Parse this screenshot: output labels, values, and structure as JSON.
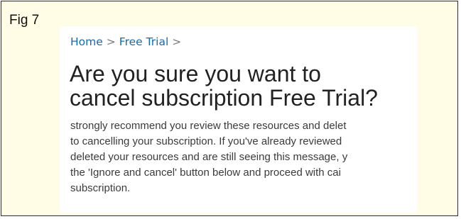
{
  "figure": {
    "label": "Fig 7"
  },
  "breadcrumb": {
    "home": "Home",
    "separator": ">",
    "free_trial": "Free Trial",
    "trailing_separator": ">"
  },
  "title": {
    "line1": "Are you sure you want to",
    "line2": "cancel subscription Free Trial?"
  },
  "body": {
    "lines": [
      "strongly recommend you review these resources and delet",
      "to cancelling your subscription. If you've already reviewed",
      "deleted your resources and are still seeing this message, y",
      "the 'Ignore and cancel' button below and proceed with cai",
      "subscription."
    ]
  },
  "colors": {
    "frame_background": "#fffde6",
    "link": "#0f6cbd",
    "title": "#222222",
    "body": "#3b3b3b"
  }
}
